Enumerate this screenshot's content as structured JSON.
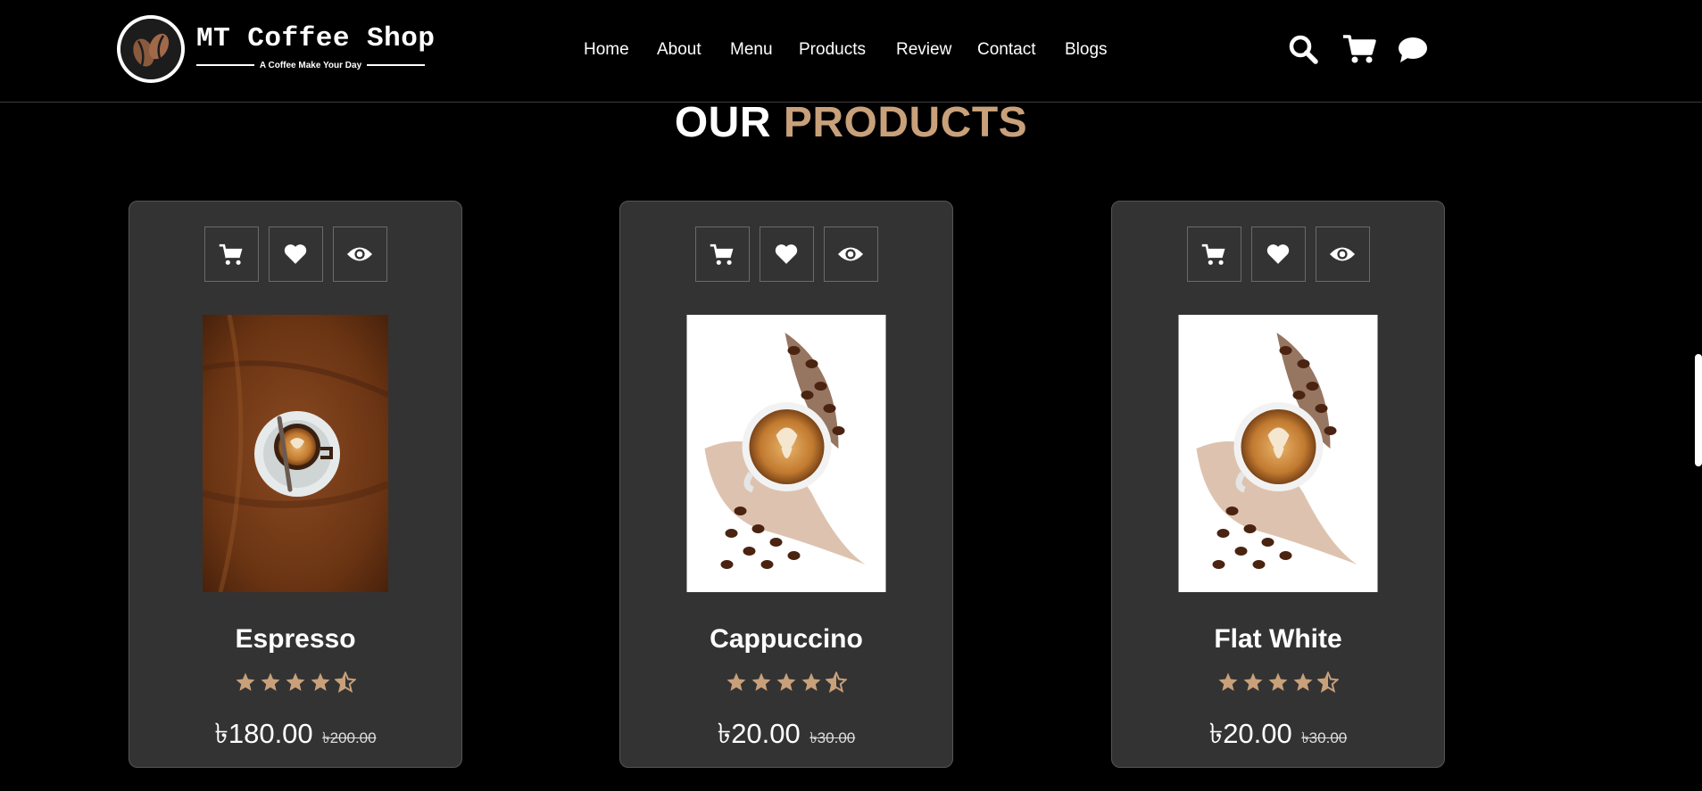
{
  "brand": {
    "name": "MT Coffee Shop",
    "tagline": "A Coffee Make Your Day"
  },
  "nav": [
    {
      "label": "Home"
    },
    {
      "label": "About"
    },
    {
      "label": "Menu"
    },
    {
      "label": "Products"
    },
    {
      "label": "Review"
    },
    {
      "label": "Contact"
    },
    {
      "label": "Blogs"
    }
  ],
  "header_icons": [
    "search-icon",
    "cart-icon",
    "chat-icon"
  ],
  "section": {
    "title_main": "OUR",
    "title_accent": "PRODUCTS"
  },
  "colors": {
    "background": "#000000",
    "card": "#333333",
    "accent": "#c8a07a",
    "text": "#ffffff"
  },
  "products": [
    {
      "name": "Espresso",
      "price": "৳180.00",
      "old_price": "৳200.00",
      "rating": 4.5
    },
    {
      "name": "Cappuccino",
      "price": "৳20.00",
      "old_price": "৳30.00",
      "rating": 4.5
    },
    {
      "name": "Flat White",
      "price": "৳20.00",
      "old_price": "৳30.00",
      "rating": 4.5
    }
  ]
}
